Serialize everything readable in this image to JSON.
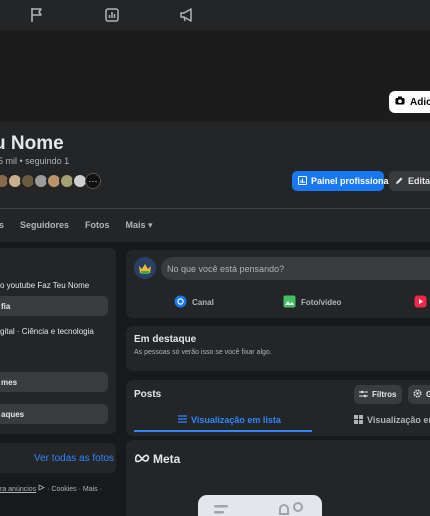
{
  "nav": {
    "icons": [
      "flag-icon",
      "chart-icon",
      "megaphone-icon"
    ]
  },
  "cover": {
    "add_button_label": "Adicio"
  },
  "profile": {
    "name": "u Nome",
    "stats": "5 mil • seguindo 1",
    "more_friends_label": "···",
    "pro_panel_label": "Painel profissional",
    "edit_label": "Editar"
  },
  "tabs": [
    "es",
    "Seguidores",
    "Fotos",
    "Mais ▾"
  ],
  "left": {
    "intro_text": "o youtube Faz Teu Nome",
    "bio_button": "fia",
    "category": "gital · Ciência e tecnologia",
    "details_button": "mes",
    "featured_button": "aques",
    "see_all_photos": "Ver todas as fotos",
    "footer_part1": "ra anúncios",
    "footer_part2": "· Cookies · Mais ·"
  },
  "composer": {
    "placeholder": "No que você está pensando?",
    "actions": [
      "Canal",
      "Foto/vídeo"
    ]
  },
  "featured": {
    "title": "Em destaque",
    "subtitle": "As pessoas só verão isso se você fixar algo."
  },
  "posts": {
    "title": "Posts",
    "filters_label": "Filtros",
    "manage_label": "G",
    "list_view": "Visualização em lista",
    "grid_view": "Visualização em g"
  },
  "meta": {
    "logo_text": "Meta"
  },
  "colors": {
    "accent": "#1877f2",
    "link": "#2d88ff",
    "card": "#242526",
    "bg": "#18191a"
  }
}
